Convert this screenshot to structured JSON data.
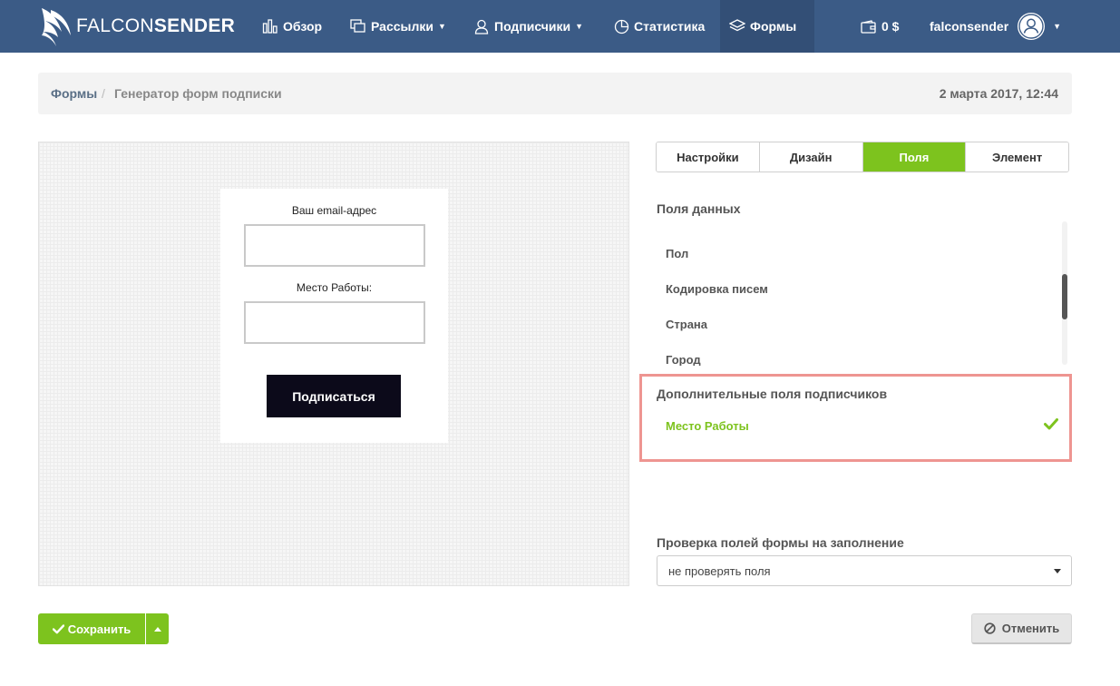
{
  "brand": {
    "name_light": "FALCON",
    "name_bold": "SENDER"
  },
  "nav": {
    "items": [
      {
        "label": "Обзор",
        "icon": "bar-chart-icon"
      },
      {
        "label": "Рассылки",
        "icon": "copy-icon",
        "dropdown": true
      },
      {
        "label": "Подписчики",
        "icon": "user-icon",
        "dropdown": true
      },
      {
        "label": "Статистика",
        "icon": "pie-chart-icon"
      },
      {
        "label": "Формы",
        "icon": "layers-icon",
        "active": true
      }
    ],
    "balance": "0 $",
    "username": "falconsender"
  },
  "breadcrumb": {
    "root": "Формы",
    "separator": "/",
    "current": "Генератор форм подписки"
  },
  "datetime": "2 марта 2017, 12:44",
  "preview": {
    "email_label": "Ваш email-адрес",
    "work_label": "Место Работы:",
    "submit_label": "Подписаться"
  },
  "tabs": [
    {
      "label": "Настройки",
      "active": false
    },
    {
      "label": "Дизайн",
      "active": false
    },
    {
      "label": "Поля",
      "active": true
    },
    {
      "label": "Элемент",
      "active": false
    }
  ],
  "data_fields": {
    "title": "Поля данных",
    "items": [
      "Пол",
      "Кодировка писем",
      "Страна",
      "Город"
    ]
  },
  "extra_fields": {
    "title": "Дополнительные поля подписчиков",
    "items": [
      {
        "label": "Место Работы",
        "checked": true
      }
    ]
  },
  "validation": {
    "title": "Проверка полей формы на заполнение",
    "selected": "не проверять поля"
  },
  "actions": {
    "save": "Сохранить",
    "cancel": "Отменить"
  },
  "colors": {
    "nav_bg": "#3b5b86",
    "accent_green": "#7dc31e",
    "highlight_border": "#ee9591"
  }
}
